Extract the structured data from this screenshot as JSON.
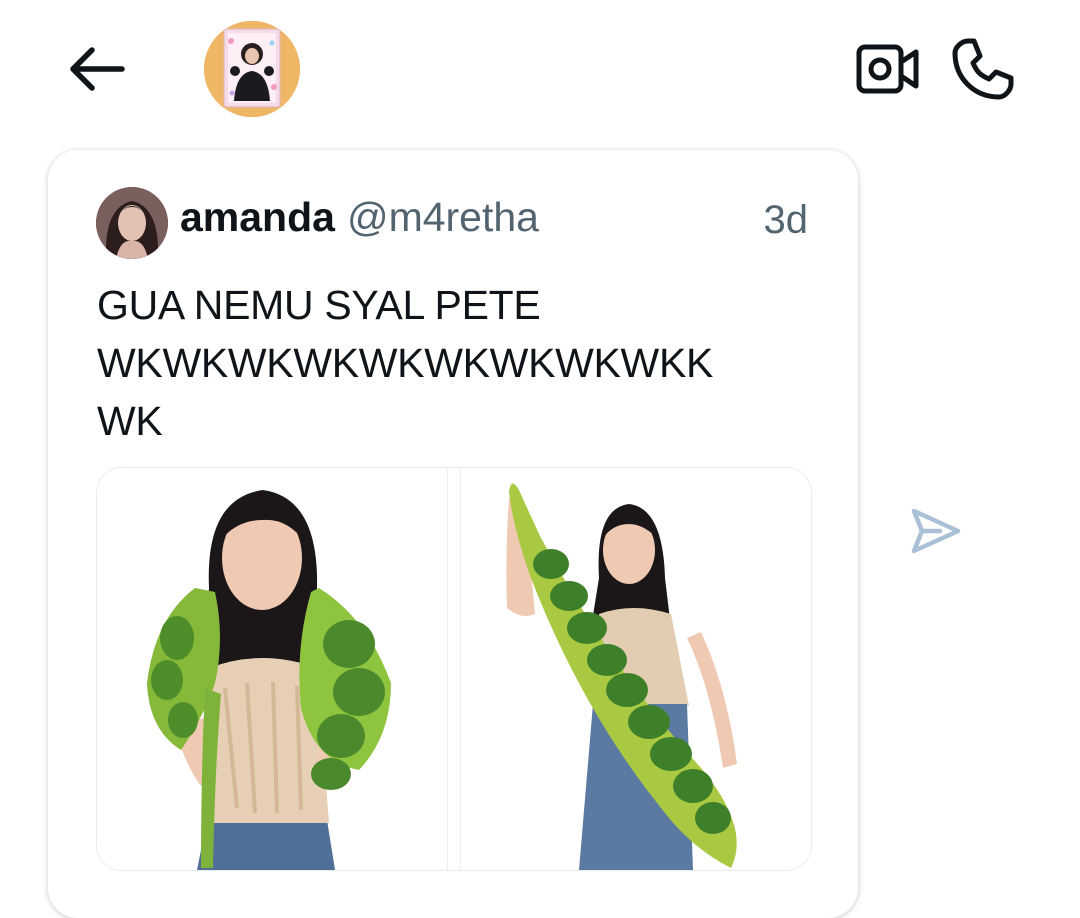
{
  "header": {
    "back_icon": "arrow-left-icon",
    "avatar": "contact-avatar",
    "video_icon": "video-camera-icon",
    "call_icon": "phone-icon"
  },
  "tweet": {
    "display_name": "amanda",
    "handle": "@m4retha",
    "time": "3d",
    "text_lines": [
      "GUA NEMU SYAL PETE",
      "WKWKWKWKWKWKWKWKWKK",
      "WK"
    ],
    "media_count": 2
  },
  "actions": {
    "send_icon": "send-icon"
  },
  "colors": {
    "text": "#0f1419",
    "secondary": "#536471",
    "accent": "#a9c0d6",
    "avatar_bg": "#efb765"
  }
}
